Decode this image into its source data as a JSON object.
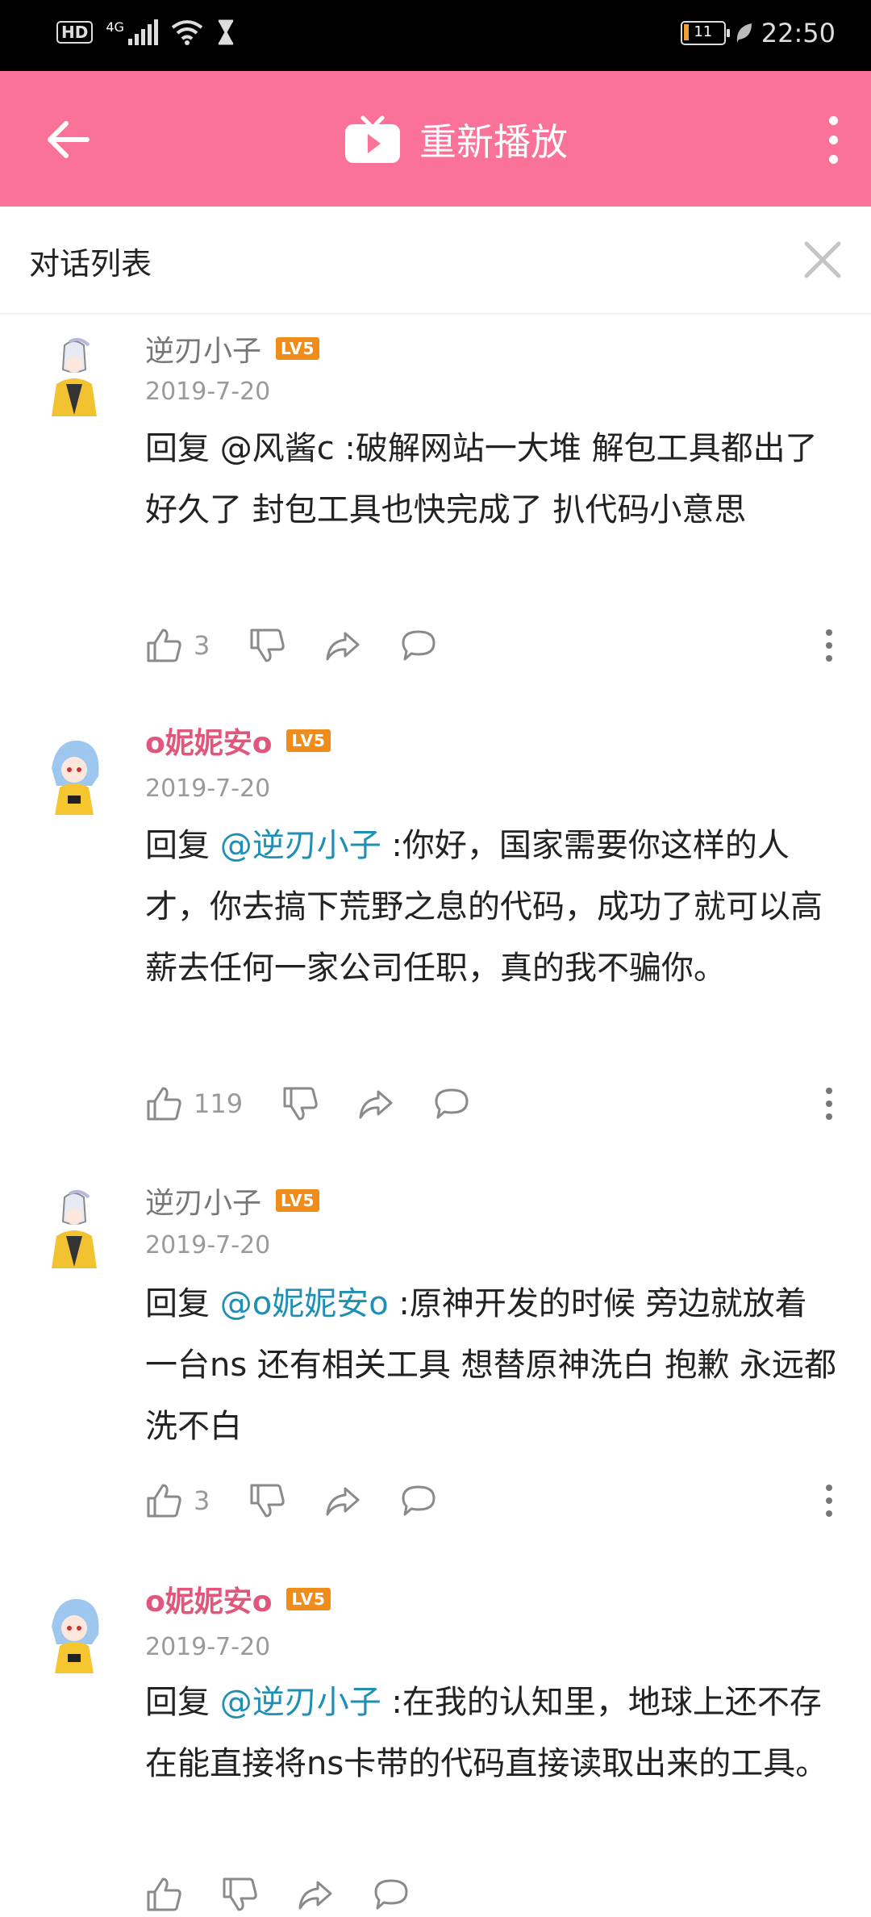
{
  "status_bar": {
    "network_badge": "HD",
    "signal_label": "4G",
    "battery_level": "11",
    "time": "22:50"
  },
  "app_bar": {
    "title": "重新播放",
    "accent": "#fb7299"
  },
  "sub_header": {
    "title": "对话列表"
  },
  "comments": [
    {
      "user": "逆刃小子",
      "level": "LV5",
      "date": "2019-7-20",
      "reply_prefix": "回复 ",
      "mention": "@风酱c",
      "mention_highlight": false,
      "text": " :破解网站一大堆 解包工具都出了好久了 封包工具也快完成了 扒代码小意思",
      "likes": "3"
    },
    {
      "user": "o妮妮安o",
      "level": "LV5",
      "date": "2019-7-20",
      "reply_prefix": "回复 ",
      "mention": "@逆刃小子",
      "mention_highlight": true,
      "text": " :你好，国家需要你这样的人才，你去搞下荒野之息的代码，成功了就可以高薪去任何一家公司任职，真的我不骗你。",
      "likes": "119"
    },
    {
      "user": "逆刃小子",
      "level": "LV5",
      "date": "2019-7-20",
      "reply_prefix": "回复 ",
      "mention": "@o妮妮安o",
      "mention_highlight": true,
      "text": " :原神开发的时候 旁边就放着一台ns 还有相关工具 想替原神洗白 抱歉 永远都洗不白",
      "likes": "3"
    },
    {
      "user": "o妮妮安o",
      "level": "LV5",
      "date": "2019-7-20",
      "reply_prefix": "回复 ",
      "mention": "@逆刃小子",
      "mention_highlight": true,
      "text": " :在我的认知里，地球上还不存在能直接将ns卡带的代码直接读取出来的工具。",
      "likes": ""
    }
  ],
  "icons": {
    "back": "arrow-left-icon",
    "tv": "tv-play-icon",
    "more": "more-vertical-icon",
    "close": "close-icon",
    "like": "thumbs-up-icon",
    "dislike": "thumbs-down-icon",
    "share": "share-icon",
    "reply": "comment-icon"
  }
}
